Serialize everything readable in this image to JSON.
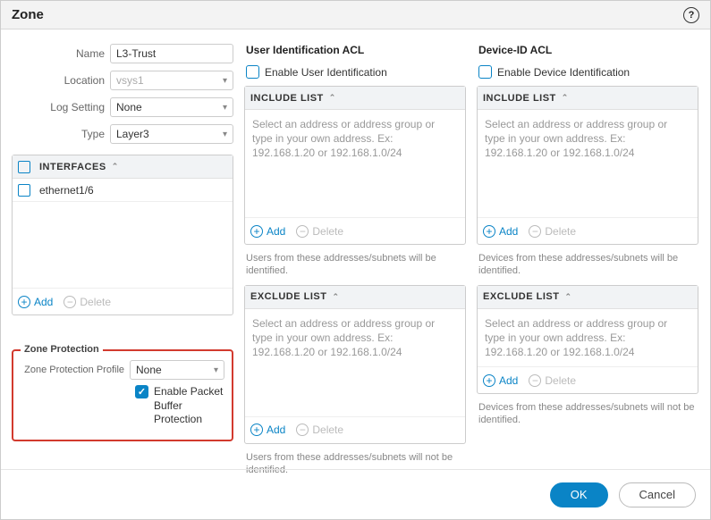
{
  "title": "Zone",
  "form": {
    "name_label": "Name",
    "name_value": "L3-Trust",
    "location_label": "Location",
    "location_value": "vsys1",
    "logsetting_label": "Log Setting",
    "logsetting_value": "None",
    "type_label": "Type",
    "type_value": "Layer3"
  },
  "interfaces": {
    "header": "INTERFACES",
    "rows": [
      "ethernet1/6"
    ],
    "add": "Add",
    "delete": "Delete"
  },
  "zone_protection": {
    "legend": "Zone Protection",
    "profile_label": "Zone Protection Profile",
    "profile_value": "None",
    "pbp_label": "Enable Packet Buffer Protection",
    "pbp_checked": true
  },
  "user_acl": {
    "title": "User Identification ACL",
    "enable_label": "Enable User Identification",
    "include_header": "INCLUDE LIST",
    "include_placeholder": "Select an address or address group or type in your own address. Ex: 192.168.1.20 or 192.168.1.0/24",
    "include_hint": "Users from these addresses/subnets will be identified.",
    "exclude_header": "EXCLUDE LIST",
    "exclude_placeholder": "Select an address or address group or type in your own address. Ex: 192.168.1.20 or 192.168.1.0/24",
    "exclude_hint": "Users from these addresses/subnets will not be identified.",
    "add": "Add",
    "delete": "Delete"
  },
  "device_acl": {
    "title": "Device-ID ACL",
    "enable_label": "Enable Device Identification",
    "include_header": "INCLUDE LIST",
    "include_placeholder": "Select an address or address group or type in your own address. Ex: 192.168.1.20 or 192.168.1.0/24",
    "include_hint": "Devices from these addresses/subnets will be identified.",
    "exclude_header": "EXCLUDE LIST",
    "exclude_placeholder": "Select an address or address group or type in your own address. Ex: 192.168.1.20 or 192.168.1.0/24",
    "exclude_hint": "Devices from these addresses/subnets will not be identified.",
    "add": "Add",
    "delete": "Delete"
  },
  "footer": {
    "ok": "OK",
    "cancel": "Cancel"
  }
}
